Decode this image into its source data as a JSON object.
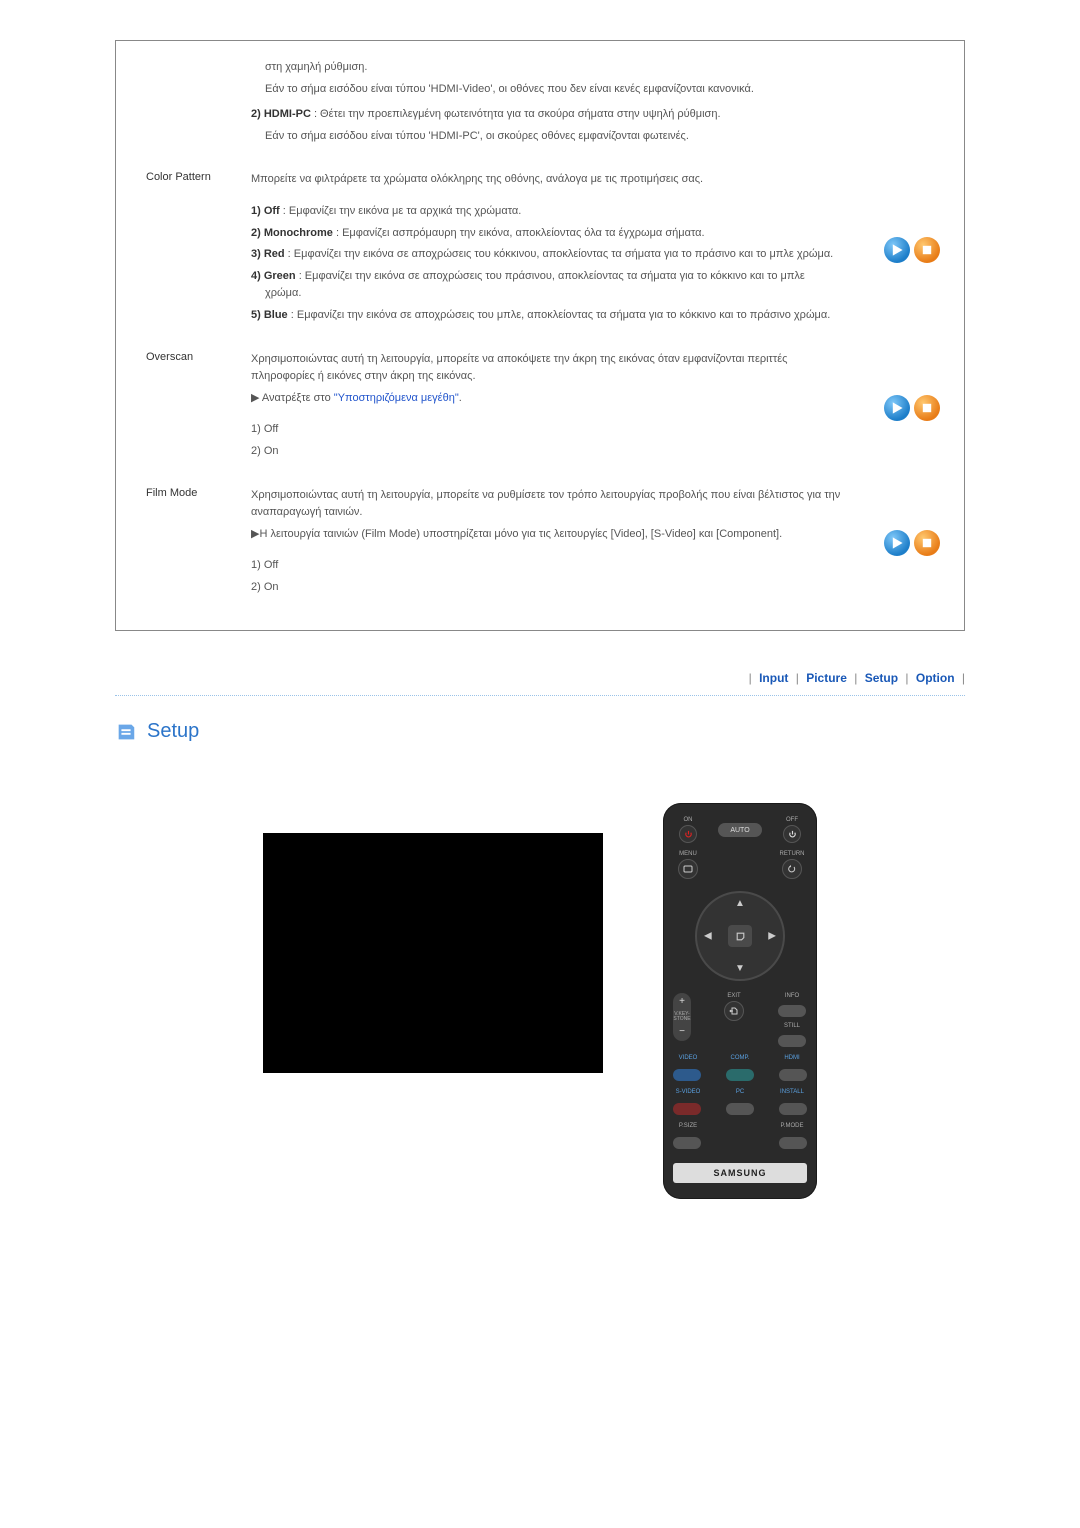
{
  "top_partial": {
    "hdmi_video_tail_1": "στη χαμηλή ρύθμιση.",
    "hdmi_video_tail_2": "Εάν το σήμα εισόδου είναι τύπου 'HDMI-Video', οι οθόνες που δεν είναι κενές εμφανίζονται κανονικά.",
    "hdmi_pc_num": "2) HDMI-PC",
    "hdmi_pc_body_1": " : Θέτει την προεπιλεγμένη φωτεινότητα για τα σκούρα σήματα στην υψηλή ρύθμιση.",
    "hdmi_pc_body_2": "Εάν το σήμα εισόδου είναι τύπου 'HDMI-PC', οι σκούρες οθόνες εμφανίζονται φωτεινές."
  },
  "sections": {
    "color_pattern": {
      "label": "Color Pattern",
      "intro": "Μπορείτε να φιλτράρετε τα χρώματα ολόκληρης της οθόνης, ανάλογα με τις προτιμήσεις σας.",
      "items": [
        {
          "b": "1) Off",
          "t": " : Εμφανίζει την εικόνα με τα αρχικά της χρώματα."
        },
        {
          "b": "2) Monochrome",
          "t": " : Εμφανίζει ασπρόμαυρη την εικόνα, αποκλείοντας όλα τα έγχρωμα σήματα."
        },
        {
          "b": "3) Red",
          "t": " : Εμφανίζει την εικόνα σε αποχρώσεις του κόκκινου, αποκλείοντας τα σήματα για το πράσινο και το μπλε χρώμα."
        },
        {
          "b": "4) Green",
          "t": " : Εμφανίζει την εικόνα σε αποχρώσεις του πράσινου, αποκλείοντας τα σήματα για το κόκκινο και το μπλε χρώμα."
        },
        {
          "b": "5) Blue",
          "t": " : Εμφανίζει την εικόνα σε αποχρώσεις του μπλε, αποκλείοντας τα σήματα για το κόκκινο και το πράσινο χρώμα."
        }
      ]
    },
    "overscan": {
      "label": "Overscan",
      "intro": "Χρησιμοποιώντας αυτή τη λειτουργία, μπορείτε να αποκόψετε την άκρη της εικόνας όταν εμφανίζονται περιττές πληροφορίες ή εικόνες στην άκρη της εικόνας.",
      "ref_pre": "▶ Ανατρέξτε στο ",
      "ref_link": "\"Υποστηριζόμενα μεγέθη\"",
      "ref_post": ".",
      "opt1": "1) Off",
      "opt2": "2) On"
    },
    "film_mode": {
      "label": "Film Mode",
      "intro": "Χρησιμοποιώντας αυτή τη λειτουργία, μπορείτε να ρυθμίσετε τον τρόπο λειτουργίας προβολής που είναι βέλτιστος για την αναπαραγωγή ταινιών.",
      "note": "▶Η λειτουργία ταινιών (Film Mode) υποστηρίζεται μόνο για τις λειτουργίες [Video], [S-Video] και [Component].",
      "opt1": "1) Off",
      "opt2": "2) On"
    }
  },
  "nav": {
    "input": "Input",
    "picture": "Picture",
    "setup": "Setup",
    "option": "Option"
  },
  "setup_section": {
    "title": "Setup"
  },
  "remote": {
    "on": "ON",
    "off": "OFF",
    "auto": "AUTO",
    "menu": "MENU",
    "return": "RETURN",
    "vkey": "V.KEY-STONE",
    "exit": "EXIT",
    "info": "INFO",
    "still": "STILL",
    "video": "VIDEO",
    "comp": "COMP.",
    "hdmi": "HDMI",
    "svideo": "S-VIDEO",
    "pc": "PC",
    "install": "INSTALL",
    "psize": "P.SIZE",
    "pmode": "P.MODE",
    "brand": "SAMSUNG"
  }
}
